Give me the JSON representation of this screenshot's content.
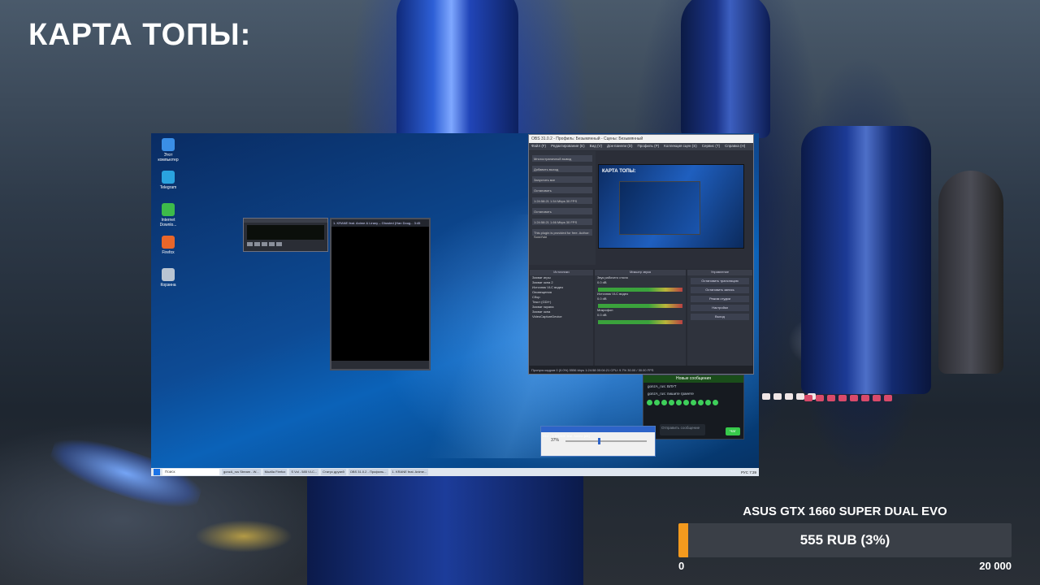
{
  "overlay": {
    "title": "КАРТА ТОПЫ:"
  },
  "desktop": {
    "icons": [
      {
        "label": "Этот компьютер",
        "color": "#3a8ee6",
        "icon": "computer-icon"
      },
      {
        "label": "Telegram",
        "color": "#2aa3df",
        "icon": "telegram-icon"
      },
      {
        "label": "Internet Downlo...",
        "color": "#3dbb4a",
        "icon": "download-manager-icon"
      },
      {
        "label": "Firefox",
        "color": "#e8662a",
        "icon": "firefox-icon"
      },
      {
        "label": "Корзина",
        "color": "#b9c4d2",
        "icon": "recycle-bin-icon"
      }
    ],
    "playlist_header": "1. KRANE feat. Anime & Lirany – Ghosted (Han Doug... 3:45",
    "obs": {
      "title": "OBS 31.0.2 - Профиль: Безымянный - Сцены: Безымянный",
      "menu": [
        "Файл (F)",
        "Редактирование (E)",
        "Вид (V)",
        "Док-панели (D)",
        "Профиль (P)",
        "Коллекция сцен (S)",
        "Сервис (T)",
        "Справка (H)"
      ],
      "left_panel": {
        "header": "Многостраничный вывод",
        "add_button": "Добавить выход",
        "start_all": "Запустить все",
        "stop_1": "Остановить",
        "stat_1": "1:24:58:21  1.54 Mbps  30 FPS",
        "stop_2": "Остановить",
        "stat_2": "1:24:58:21  1.66 Mbps  30 FPS",
        "footer": "This plugin is provided for free. Author: SoraYuki"
      },
      "preview_title": "КАРТА ТОПЫ:",
      "sources": {
        "header": "Источники",
        "items": [
          "Захват игры",
          "Захват окна 2",
          "Источник VLC видео",
          "Оповещения",
          "Сбор",
          "Текст (GDI+)",
          "Захват экрана",
          "Захват окна",
          "VideoCaptureDevice"
        ]
      },
      "mixer": {
        "header": "Микшер звука",
        "tracks": [
          {
            "name": "Звук рабочего стола",
            "db": "0.0 dB"
          },
          {
            "name": "Источник VLC видео",
            "db": "0.0 dB"
          },
          {
            "name": "Микрофон",
            "db": "0.0 dB"
          }
        ]
      },
      "controls": {
        "header": "Управление",
        "buttons": [
          "Остановить трансляцию",
          "Остановить запись",
          "Режим студии",
          "Настройки",
          "Выход"
        ]
      },
      "status": "Пропуск кадров 0 (0.0%)   5556 kbps   1:24:58   00:04:21   CPU: 9.7%   30.00 / 30.00 FPS"
    },
    "chat": {
      "header": "Новые сообщения",
      "messages": [
        "gonzA_rus: ВЛУТ",
        "gonzA_rus: пишите граеете"
      ],
      "input_placeholder": "Отправить сообщение",
      "send_label": "Чат"
    },
    "volume_window": {
      "title": "VLC - 1 KRANE feat. Anime [Alt]",
      "value": "37%"
    },
    "taskbar": {
      "search": "Поиск",
      "tasks": [
        "gonzA_rus Stream - W...",
        "Mozilla Firefox",
        "S Vol - 585 VLC...",
        "Статус друзей",
        "OBS 31.0.2 - Профиль...",
        "1. KRANE feat. Anime..."
      ],
      "tray": "РУС  7:39"
    }
  },
  "donation_goal": {
    "title": "ASUS GTX 1660 SUPER DUAL EVO",
    "progress_label": "555 RUB (3%)",
    "progress_percent": 3,
    "current": 555,
    "min_label": "0",
    "max_label": "20 000",
    "fill_color": "#f39a1e"
  }
}
